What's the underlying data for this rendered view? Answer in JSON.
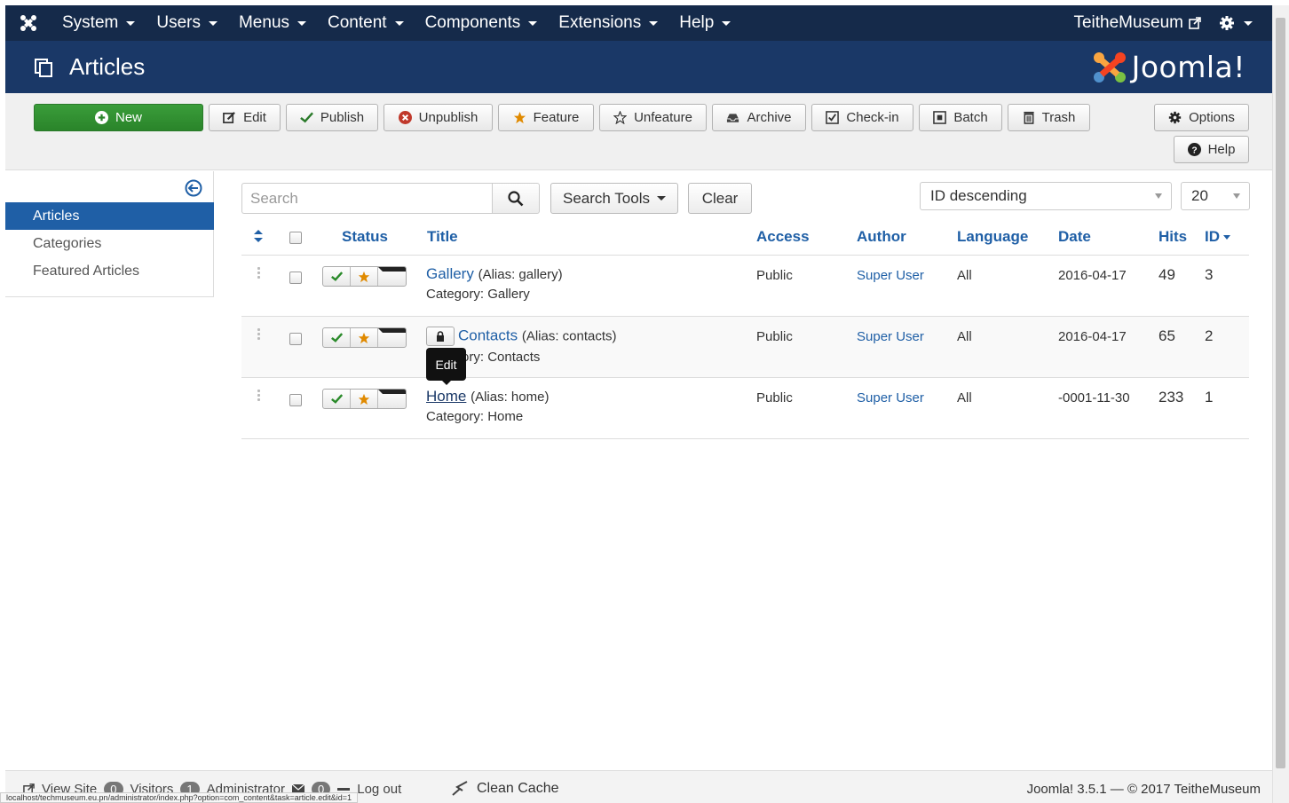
{
  "topnav": {
    "menu": [
      "System",
      "Users",
      "Menus",
      "Content",
      "Components",
      "Extensions",
      "Help"
    ],
    "site_name": "TeitheMuseum"
  },
  "titlebar": {
    "title": "Articles",
    "brand": "Joomla!"
  },
  "toolbar": {
    "new": "New",
    "edit": "Edit",
    "publish": "Publish",
    "unpublish": "Unpublish",
    "feature": "Feature",
    "unfeature": "Unfeature",
    "archive": "Archive",
    "checkin": "Check-in",
    "batch": "Batch",
    "trash": "Trash",
    "options": "Options",
    "help": "Help"
  },
  "sidebar": {
    "items": [
      "Articles",
      "Categories",
      "Featured Articles"
    ]
  },
  "filters": {
    "search_placeholder": "Search",
    "search_tools": "Search Tools",
    "clear": "Clear",
    "ordering": "ID descending",
    "limit": "20"
  },
  "table": {
    "headers": {
      "status": "Status",
      "title": "Title",
      "access": "Access",
      "author": "Author",
      "language": "Language",
      "date": "Date",
      "hits": "Hits",
      "id": "ID"
    },
    "rows": [
      {
        "title": "Gallery",
        "alias": "(Alias: gallery)",
        "category": "Category: Gallery",
        "access": "Public",
        "author": "Super User",
        "language": "All",
        "date": "2016-04-17",
        "hits": "49",
        "id": "3"
      },
      {
        "title": "Contacts",
        "alias": "(Alias: contacts)",
        "category": "Category: Contacts",
        "access": "Public",
        "author": "Super User",
        "language": "All",
        "date": "2016-04-17",
        "hits": "65",
        "id": "2"
      },
      {
        "title": "Home",
        "alias": "(Alias: home)",
        "category": "Category: Home",
        "access": "Public",
        "author": "Super User",
        "language": "All",
        "date": "-0001-11-30",
        "hits": "233",
        "id": "1"
      }
    ]
  },
  "tooltip": "Edit",
  "footer": {
    "view_site": "View Site",
    "visitors_count": "0",
    "visitors": "Visitors",
    "admins_count": "1",
    "admins": "Administrator",
    "messages_count": "0",
    "logout": "Log out",
    "clean_cache": "Clean Cache",
    "version": "Joomla! 3.5.1 — © 2017 TeitheMuseum"
  },
  "status_url": "localhost/techmuseum.eu.pn/administrator/index.php?option=com_content&task=article.edit&id=1",
  "colors": {
    "nav": "#152a4a",
    "titlebar": "#1a3867",
    "accent": "#1f5fa6",
    "new_button": "#2f8f2f"
  }
}
